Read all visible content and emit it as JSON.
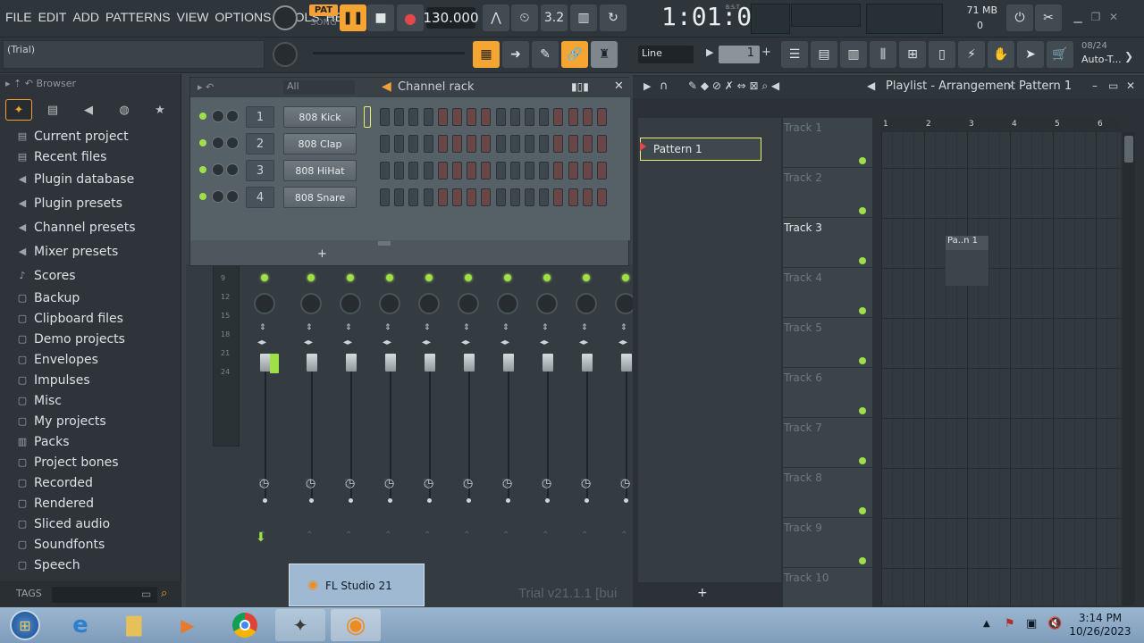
{
  "menu": [
    "FILE",
    "EDIT",
    "ADD",
    "PATTERNS",
    "VIEW",
    "OPTIONS",
    "TOOLS",
    "HELP"
  ],
  "transport": {
    "pat_label": "PAT",
    "song_label": "SONG",
    "tempo": "130.000",
    "time": "1:01:00",
    "time_unit": "B:S:T"
  },
  "resources": {
    "memory": "71 MB",
    "cpu_count": "0"
  },
  "hint_bar": "(Trial)",
  "snap": "Line",
  "pattern_number": "1",
  "cpu_panel": {
    "date": "08/24",
    "label": "Auto-T..."
  },
  "browser": {
    "title": "Browser",
    "items": [
      "Current project",
      "Recent files",
      "Plugin database",
      "Plugin presets",
      "Channel presets",
      "Mixer presets",
      "Scores",
      "Backup",
      "Clipboard files",
      "Demo projects",
      "Envelopes",
      "Impulses",
      "Misc",
      "My projects",
      "Packs",
      "Project bones",
      "Recorded",
      "Rendered",
      "Sliced audio",
      "Soundfonts",
      "Speech"
    ],
    "tags_label": "TAGS"
  },
  "channel_rack": {
    "filter": "All",
    "title": "Channel rack",
    "channels": [
      {
        "num": "1",
        "name": "808 Kick"
      },
      {
        "num": "2",
        "name": "808 Clap"
      },
      {
        "num": "3",
        "name": "808 HiHat"
      },
      {
        "num": "4",
        "name": "808 Snare"
      }
    ],
    "add_label": "+"
  },
  "mixer": {
    "meter_ticks": [
      "9",
      "12",
      "15",
      "18",
      "21",
      "24"
    ]
  },
  "playlist": {
    "title": "Playlist - Arrangement",
    "pattern": "Pattern 1",
    "pattern_list_item": "Pattern 1",
    "ruler": [
      "1",
      "2",
      "3",
      "4",
      "5",
      "6"
    ],
    "tracks": [
      "Track 1",
      "Track 2",
      "Track 3",
      "Track 4",
      "Track 5",
      "Track 6",
      "Track 7",
      "Track 8",
      "Track 9",
      "Track 10"
    ],
    "clip_label": "Pa..n 1",
    "add_label": "+"
  },
  "watermark": "Trial v21.1.1 [bui",
  "taskbar": {
    "preview_title": "FL Studio 21",
    "time": "3:14 PM",
    "date": "10/26/2023"
  },
  "colors": {
    "accent": "#f5a532",
    "led": "#9fe049",
    "background": "#3a4248"
  }
}
